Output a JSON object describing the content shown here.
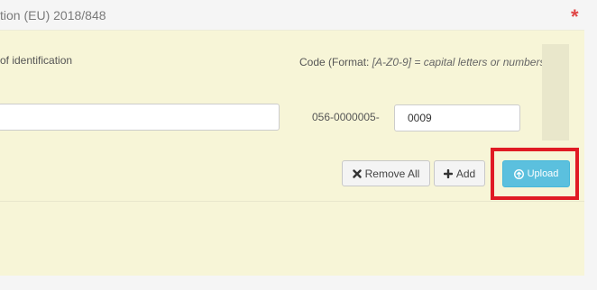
{
  "header": {
    "title": "tion (EU) 2018/848",
    "required_marker": "*"
  },
  "form": {
    "identification_label": "of identification",
    "code_label": {
      "prefix": "Code (Format: ",
      "format": "[A-Z0-9] = capital letters or numbers",
      "suffix": ")"
    },
    "identification_value": "",
    "code_prefix": "056-0000005-",
    "code_value": "0009"
  },
  "buttons": {
    "remove_all": "Remove All",
    "add": "Add",
    "upload": "Upload"
  },
  "icons": {
    "remove_all": "times-icon",
    "add": "plus-icon",
    "upload": "upload-circle-icon"
  },
  "colors": {
    "panel_bg": "#f7f5d7",
    "upload_bg": "#5bc0de",
    "highlight": "#e01b24",
    "required": "#e04545"
  }
}
